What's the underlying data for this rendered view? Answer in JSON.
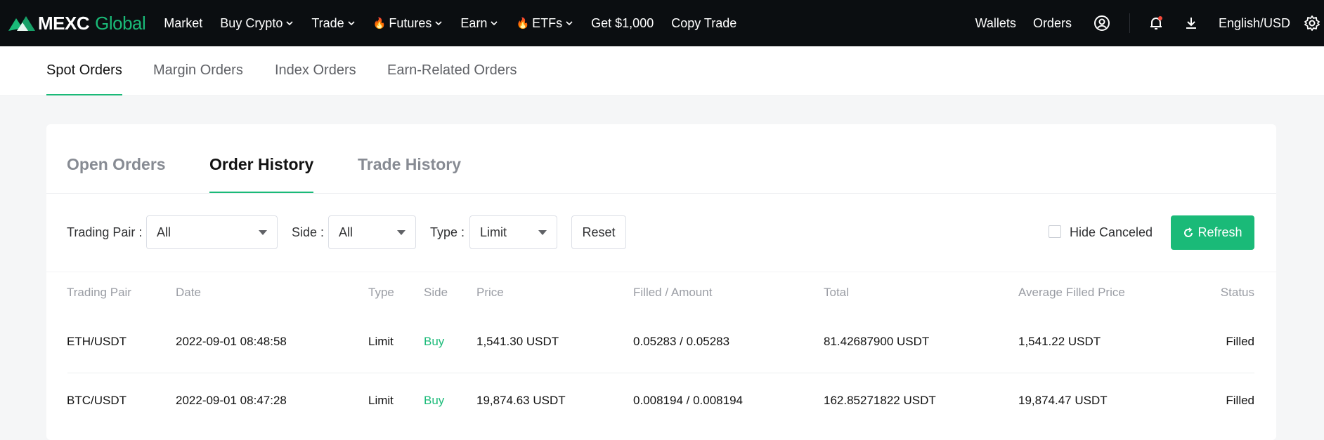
{
  "header": {
    "logo_main": "MEXC",
    "logo_accent": "Global",
    "nav": [
      {
        "label": "Market",
        "dropdown": false,
        "fire": false
      },
      {
        "label": "Buy Crypto",
        "dropdown": true,
        "fire": false
      },
      {
        "label": "Trade",
        "dropdown": true,
        "fire": false
      },
      {
        "label": "Futures",
        "dropdown": true,
        "fire": true
      },
      {
        "label": "Earn",
        "dropdown": true,
        "fire": false
      },
      {
        "label": "ETFs",
        "dropdown": true,
        "fire": true
      },
      {
        "label": "Get $1,000",
        "dropdown": false,
        "fire": false
      },
      {
        "label": "Copy Trade",
        "dropdown": false,
        "fire": false
      }
    ],
    "wallets": "Wallets",
    "orders": "Orders",
    "language": "English/USD",
    "accent_color": "#1aba78"
  },
  "subnav": {
    "tabs": [
      "Spot Orders",
      "Margin Orders",
      "Index Orders",
      "Earn-Related Orders"
    ],
    "active": "Spot Orders"
  },
  "orders": {
    "tabs": [
      "Open Orders",
      "Order History",
      "Trade History"
    ],
    "active": "Order History"
  },
  "filters": {
    "trading_pair_label": "Trading Pair",
    "trading_pair_value": "All",
    "side_label": "Side",
    "side_value": "All",
    "type_label": "Type",
    "type_value": "Limit",
    "reset": "Reset",
    "hide_canceled": "Hide Canceled",
    "refresh": "Refresh"
  },
  "table": {
    "headers": [
      "Trading Pair",
      "Date",
      "Type",
      "Side",
      "Price",
      "Filled / Amount",
      "Total",
      "Average Filled Price",
      "Status"
    ],
    "rows": [
      {
        "pair": "ETH/USDT",
        "date": "2022-09-01 08:48:58",
        "type": "Limit",
        "side": "Buy",
        "price": "1,541.30 USDT",
        "filled": "0.05283 / 0.05283",
        "total": "81.42687900 USDT",
        "avg": "1,541.22 USDT",
        "status": "Filled"
      },
      {
        "pair": "BTC/USDT",
        "date": "2022-09-01 08:47:28",
        "type": "Limit",
        "side": "Buy",
        "price": "19,874.63 USDT",
        "filled": "0.008194 / 0.008194",
        "total": "162.85271822 USDT",
        "avg": "19,874.47 USDT",
        "status": "Filled"
      }
    ]
  }
}
